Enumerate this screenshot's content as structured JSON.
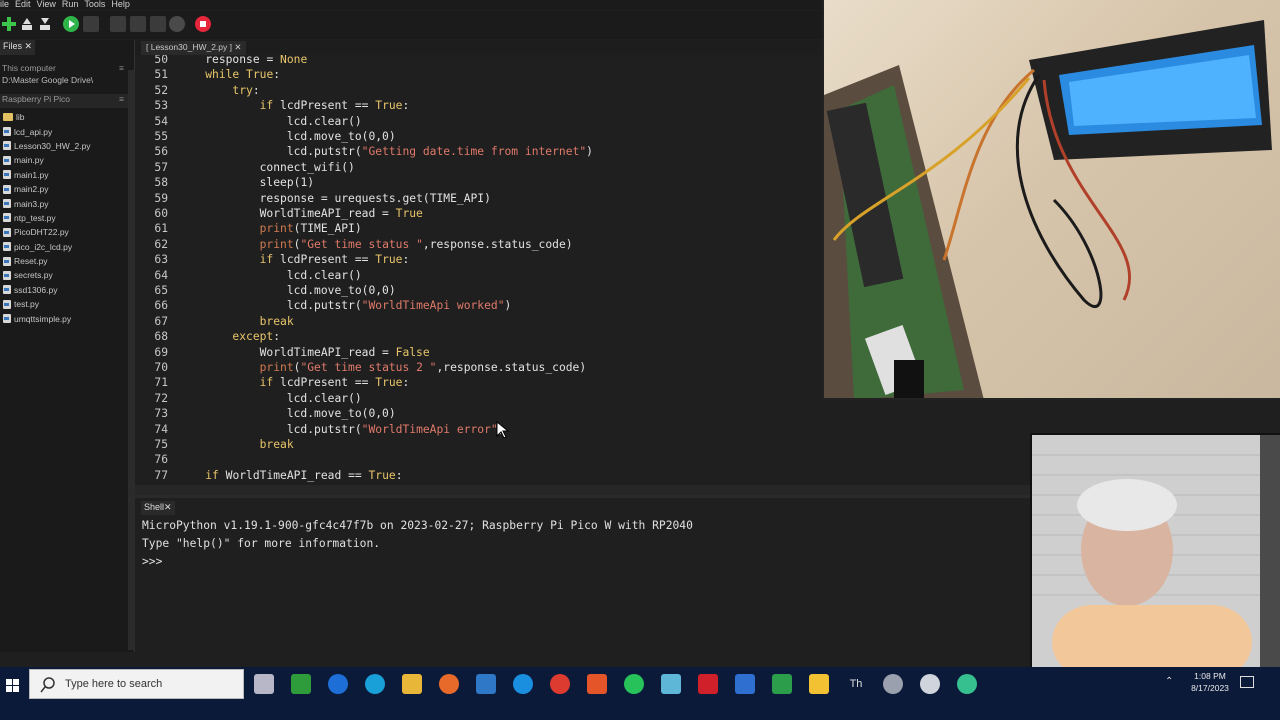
{
  "menu": [
    "ile",
    "Edit",
    "View",
    "Run",
    "Tools",
    "Help"
  ],
  "files_pane": {
    "tab_label": "Files",
    "this_computer_label": "This computer",
    "this_computer_path": "D:\\Master Google Drive\\",
    "device_label": "Raspberry Pi Pico",
    "files": [
      "lib",
      "lcd_api.py",
      "Lesson30_HW_2.py",
      "main.py",
      "main1.py",
      "main2.py",
      "main3.py",
      "ntp_test.py",
      "PicoDHT22.py",
      "pico_i2c_lcd.py",
      "Reset.py",
      "secrets.py",
      "ssd1306.py",
      "test.py",
      "umqttsimple.py"
    ]
  },
  "editor": {
    "tab_label": "[ Lesson30_HW_2.py ] ✕",
    "lines": [
      {
        "n": "50",
        "t": "    response = None"
      },
      {
        "n": "51",
        "t": "    while True:"
      },
      {
        "n": "52",
        "t": "        try:"
      },
      {
        "n": "53",
        "t": "            if lcdPresent == True:"
      },
      {
        "n": "54",
        "t": "                lcd.clear()"
      },
      {
        "n": "55",
        "t": "                lcd.move_to(0,0)"
      },
      {
        "n": "56",
        "t": "                lcd.putstr(\"Getting date.time from internet\")"
      },
      {
        "n": "57",
        "t": "            connect_wifi()"
      },
      {
        "n": "58",
        "t": "            sleep(1)"
      },
      {
        "n": "59",
        "t": "            response = urequests.get(TIME_API)"
      },
      {
        "n": "60",
        "t": "            WorldTimeAPI_read = True"
      },
      {
        "n": "61",
        "t": "            print(TIME_API)"
      },
      {
        "n": "62",
        "t": "            print(\"Get time status \",response.status_code)"
      },
      {
        "n": "63",
        "t": "            if lcdPresent == True:"
      },
      {
        "n": "64",
        "t": "                lcd.clear()"
      },
      {
        "n": "65",
        "t": "                lcd.move_to(0,0)"
      },
      {
        "n": "66",
        "t": "                lcd.putstr(\"WorldTimeApi worked\")"
      },
      {
        "n": "67",
        "t": "            break"
      },
      {
        "n": "68",
        "t": "        except:"
      },
      {
        "n": "69",
        "t": "            WorldTimeAPI_read = False"
      },
      {
        "n": "70",
        "t": "            print(\"Get time status 2 \",response.status_code)"
      },
      {
        "n": "71",
        "t": "            if lcdPresent == True:"
      },
      {
        "n": "72",
        "t": "                lcd.clear()"
      },
      {
        "n": "73",
        "t": "                lcd.move_to(0,0)"
      },
      {
        "n": "74",
        "t": "                lcd.putstr(\"WorldTimeApi error\")"
      },
      {
        "n": "75",
        "t": "            break"
      },
      {
        "n": "76",
        "t": ""
      },
      {
        "n": "77",
        "t": "    if WorldTimeAPI_read == True:"
      }
    ]
  },
  "shell": {
    "tab_label": "Shell",
    "lines": [
      "MicroPython v1.19.1-900-gfc4c47f7b on 2023-02-27; Raspberry Pi Pico W with RP2040",
      "Type \"help()\" for more information.",
      ">>> "
    ]
  },
  "taskbar": {
    "search_placeholder": "Type here to search",
    "time": "1:08 PM",
    "date": "8/17/2023"
  },
  "colors": {
    "editor_bg": "#1f1f1f",
    "keyword": "#e8c56a",
    "string": "#e07a6a",
    "taskbar_bg": "#0c1a3a"
  }
}
